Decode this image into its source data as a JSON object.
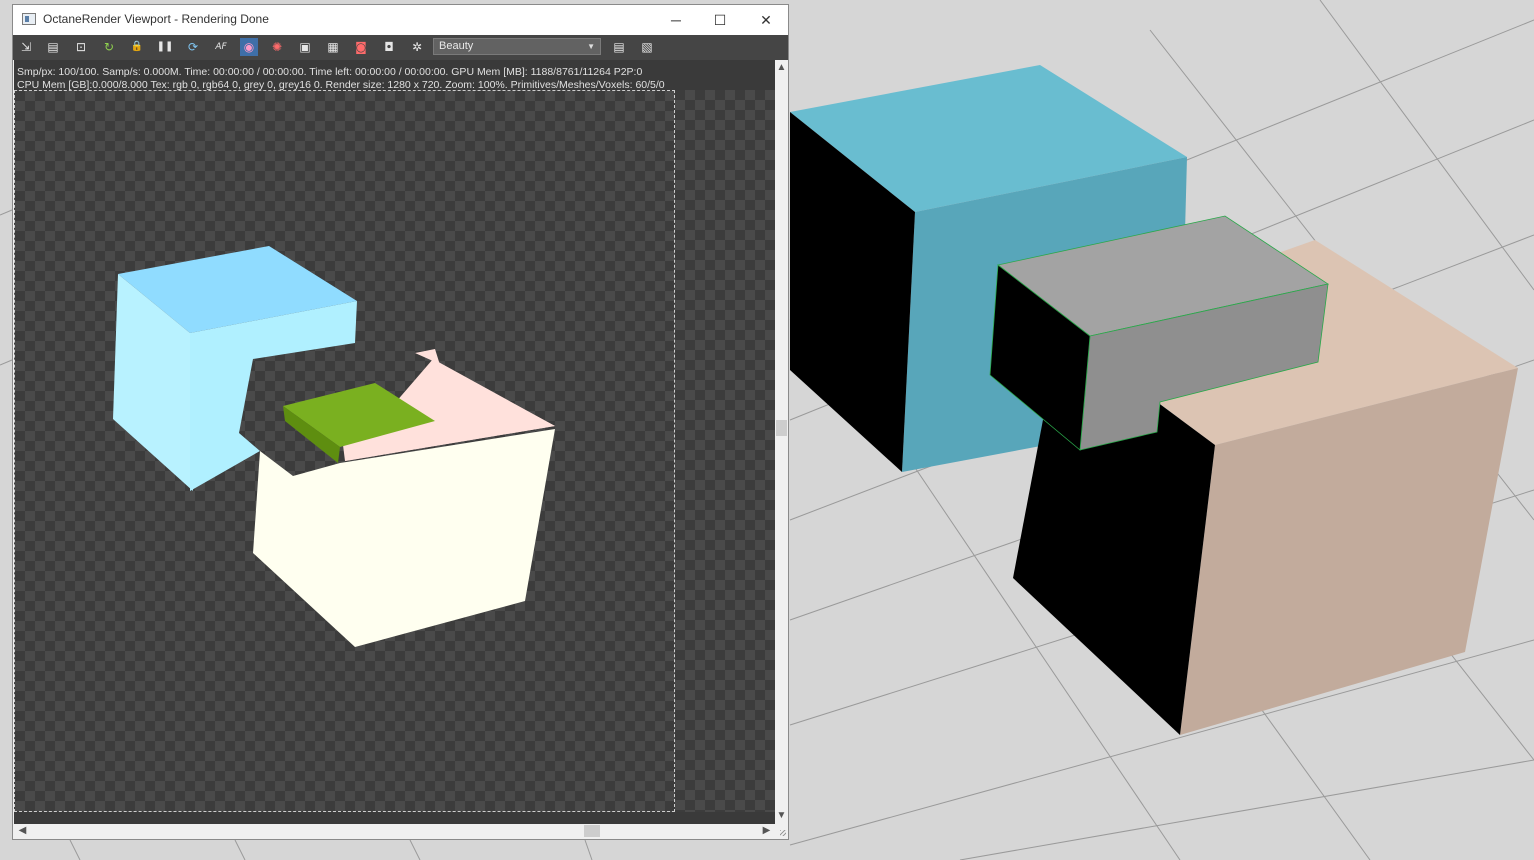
{
  "window": {
    "title": "OctaneRender Viewport - Rendering Done",
    "minimize_glyph": "─",
    "maximize_glyph": "☐",
    "close_glyph": "✕"
  },
  "toolbar": {
    "icons": [
      {
        "name": "send-scene-icon",
        "glyph": "⇲"
      },
      {
        "name": "clipboard-icon",
        "glyph": "▤"
      },
      {
        "name": "zoom-region-icon",
        "glyph": "⊡"
      },
      {
        "name": "restart-icon",
        "glyph": "↻"
      },
      {
        "name": "lock-icon",
        "glyph": "🔒"
      },
      {
        "name": "pause-icon",
        "glyph": "❚❚"
      },
      {
        "name": "refresh-icon",
        "glyph": "⟳"
      },
      {
        "name": "focus-picker-icon",
        "glyph": "AF"
      },
      {
        "name": "color-picker-icon",
        "glyph": "◉"
      },
      {
        "name": "material-picker-icon",
        "glyph": "✺"
      },
      {
        "name": "region-render-icon",
        "glyph": "▣"
      },
      {
        "name": "film-region-icon",
        "glyph": "▦"
      },
      {
        "name": "camera-view-icon",
        "glyph": "◙"
      },
      {
        "name": "snapshot-icon",
        "glyph": "◘"
      },
      {
        "name": "settings-gear-icon",
        "glyph": "✲"
      }
    ],
    "render_pass": "Beauty",
    "right_icons": [
      {
        "name": "table-view-icon",
        "glyph": "▤"
      },
      {
        "name": "image-view-icon",
        "glyph": "▧"
      }
    ]
  },
  "stats": {
    "line1": "Smp/px: 100/100.   Samp/s: 0.000M.   Time: 00:00:00 / 00:00:00.   Time left: 00:00:00 / 00:00:00.   GPU Mem [MB]: 1188/8761/11264 P2P:0",
    "line2": "CPU Mem [GB]:0.000/8.000   Tex: rgb 0, rgb64 0, grey 0, grey16 0.   Render size: 1280 x 720.   Zoom: 100%.   Primitives/Meshes/Voxels: 60/5/0"
  },
  "scroll": {
    "up": "▲",
    "down": "▼",
    "left": "◀",
    "right": "▶"
  },
  "colors": {
    "cube_blue_top": "#69bdd0",
    "cube_blue_front": "#58a6ba",
    "cube_peach_top": "#dcc4b3",
    "cube_peach_front": "#c2ab9c",
    "cube_grey_top": "#a3a3a3",
    "cube_grey_front": "#8f8f8f",
    "render_cyan_front": "#b8f2ff",
    "render_cyan_top": "#90dcff",
    "render_cream": "#fffff0",
    "render_pink": "#ffe1dc",
    "render_green": "#7ab020"
  }
}
